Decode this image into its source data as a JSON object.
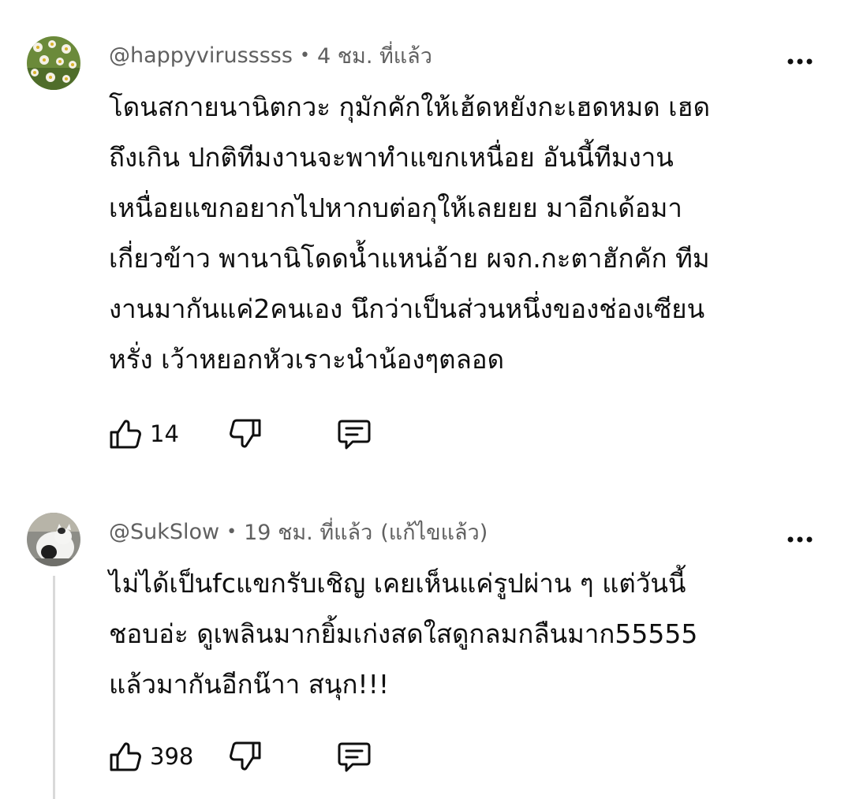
{
  "comments": [
    {
      "author": "@happyvirusssss",
      "time": "4 ชม. ที่แล้ว",
      "edited": "",
      "lines": [
        "โดนสกายนานิตกวะ กุมักคักให้เฮ้ดหยังกะเฮดหมด เฮด",
        "ถึงเกิน ปกติทีมงานจะพาทำแขกเหนื่อย อันนี้ทีมงาน",
        "เหนื่อยแขกอยากไปหากบต่อกุให้เลยยย มาอีกเด้อมา",
        "เกี่ยวข้าว พานานิโดดน้ำแหน่อ้าย ผจก.กะตาฮักคัก ทีม",
        "งานมากันแค่2คนเอง นึกว่าเป็นส่วนหนึ่งของช่องเซียน",
        "หรั่ง เว้าหยอกหัวเราะนำน้องๆตลอด"
      ],
      "likes": "14",
      "avatar_icon": "flower-photo-avatar"
    },
    {
      "author": "@SukSlow",
      "time": "19 ชม. ที่แล้ว",
      "edited": "(แก้ไขแล้ว)",
      "lines": [
        "ไม่ได้เป็นfcแขกรับเชิญ เคยเห็นแค่รูปผ่าน ๆ แต่วันนี้",
        "ชอบอ่ะ ดูเพลินมากยิ้มเก่งสดใสดูกลมกลืนมาก55555",
        "แล้วมากันอีกน๊าา สนุก!!!"
      ],
      "likes": "398",
      "avatar_icon": "cat-photo-avatar"
    }
  ],
  "separator": "•",
  "icons": {
    "like": "thumbs-up-icon",
    "dislike": "thumbs-down-icon",
    "reply": "reply-comment-icon",
    "more": "more-options-icon"
  }
}
